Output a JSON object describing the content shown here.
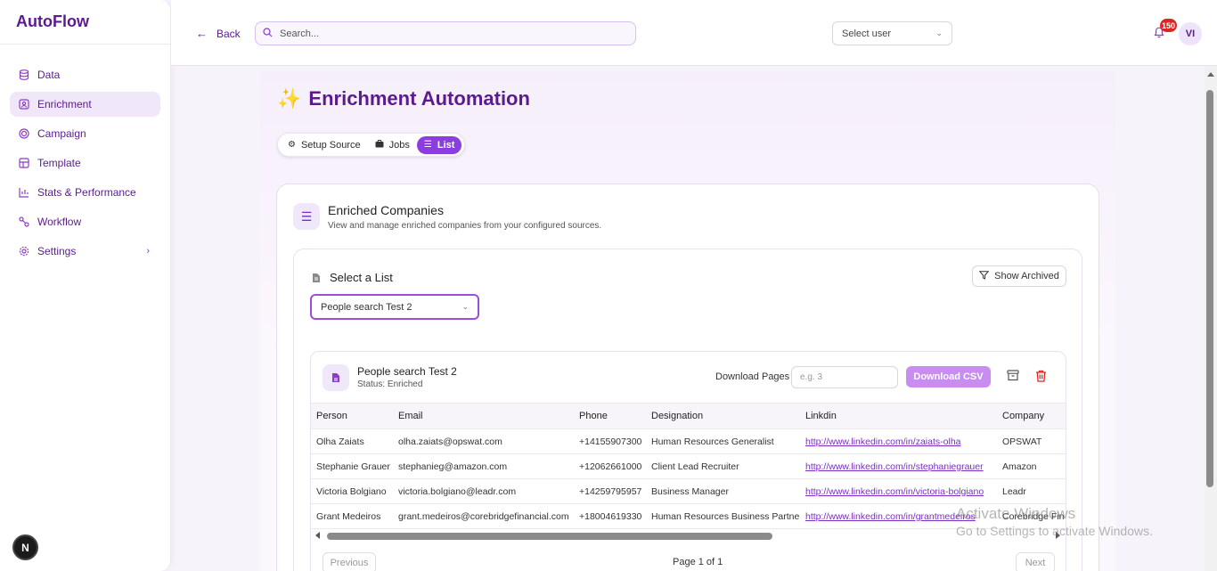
{
  "app": {
    "brand": "AutoFlow"
  },
  "sidebar": {
    "items": [
      {
        "label": "Data",
        "icon": "database-icon"
      },
      {
        "label": "Enrichment",
        "icon": "user-card-icon",
        "active": true
      },
      {
        "label": "Campaign",
        "icon": "target-icon"
      },
      {
        "label": "Template",
        "icon": "template-icon"
      },
      {
        "label": "Stats & Performance",
        "icon": "chart-icon"
      },
      {
        "label": "Workflow",
        "icon": "workflow-icon"
      },
      {
        "label": "Settings",
        "icon": "gear-icon"
      }
    ],
    "badge": "N"
  },
  "topbar": {
    "back_label": "Back",
    "search_placeholder": "Search...",
    "user_select": "Select user",
    "notification_count": "150",
    "avatar_initials": "VI"
  },
  "page": {
    "title": "Enrichment Automation",
    "tabs": [
      {
        "label": "Setup Source",
        "icon": "gear-icon"
      },
      {
        "label": "Jobs",
        "icon": "briefcase-icon"
      },
      {
        "label": "List",
        "icon": "list-icon",
        "active": true
      }
    ]
  },
  "card": {
    "title": "Enriched Companies",
    "subtitle": "View and manage enriched companies from your configured sources.",
    "select_list_title": "Select a List",
    "show_archived": "Show Archived",
    "selected_list": "People search Test 2"
  },
  "list_panel": {
    "title": "People search Test 2",
    "status": "Status: Enriched",
    "download_pages_label": "Download Pages",
    "download_pages_placeholder": "e.g. 3",
    "download_button": "Download CSV"
  },
  "table": {
    "columns": [
      "Person",
      "Email",
      "Phone",
      "Designation",
      "Linkdin",
      "Company"
    ],
    "rows": [
      [
        "Olha Zaiats",
        "olha.zaiats@opswat.com",
        "+14155907300",
        "Human Resources Generalist",
        "http://www.linkedin.com/in/zaiats-olha",
        "OPSWAT"
      ],
      [
        "Stephanie Grauer",
        "stephanieg@amazon.com",
        "+12062661000",
        "Client Lead Recruiter",
        "http://www.linkedin.com/in/stephaniegrauer",
        "Amazon"
      ],
      [
        "Victoria Bolgiano",
        "victoria.bolgiano@leadr.com",
        "+14259795957",
        "Business Manager",
        "http://www.linkedin.com/in/victoria-bolgiano",
        "Leadr"
      ],
      [
        "Grant Medeiros",
        "grant.medeiros@corebridgefinancial.com",
        "+18004619330",
        "Human Resources Business Partner",
        "http://www.linkedin.com/in/grantmedeiros",
        "Corebridge Fin"
      ]
    ]
  },
  "pager": {
    "prev": "Previous",
    "info": "Page 1 of 1",
    "next": "Next"
  },
  "watermark": {
    "line1": "Activate Windows",
    "line2": "Go to Settings to activate Windows."
  }
}
